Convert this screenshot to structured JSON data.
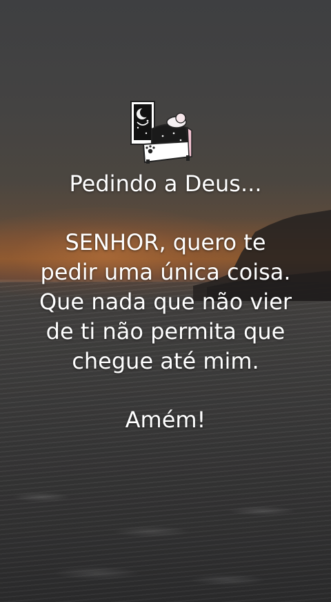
{
  "title": "Pedindo a Deus...",
  "prayer_lines": [
    "SENHOR, quero te",
    "pedir uma única coisa.",
    "Que nada que não vier",
    "de ti não permita que",
    "chegue até mim."
  ],
  "closing": "Amém!",
  "sticker_icon": "bed-sleeping-icon"
}
